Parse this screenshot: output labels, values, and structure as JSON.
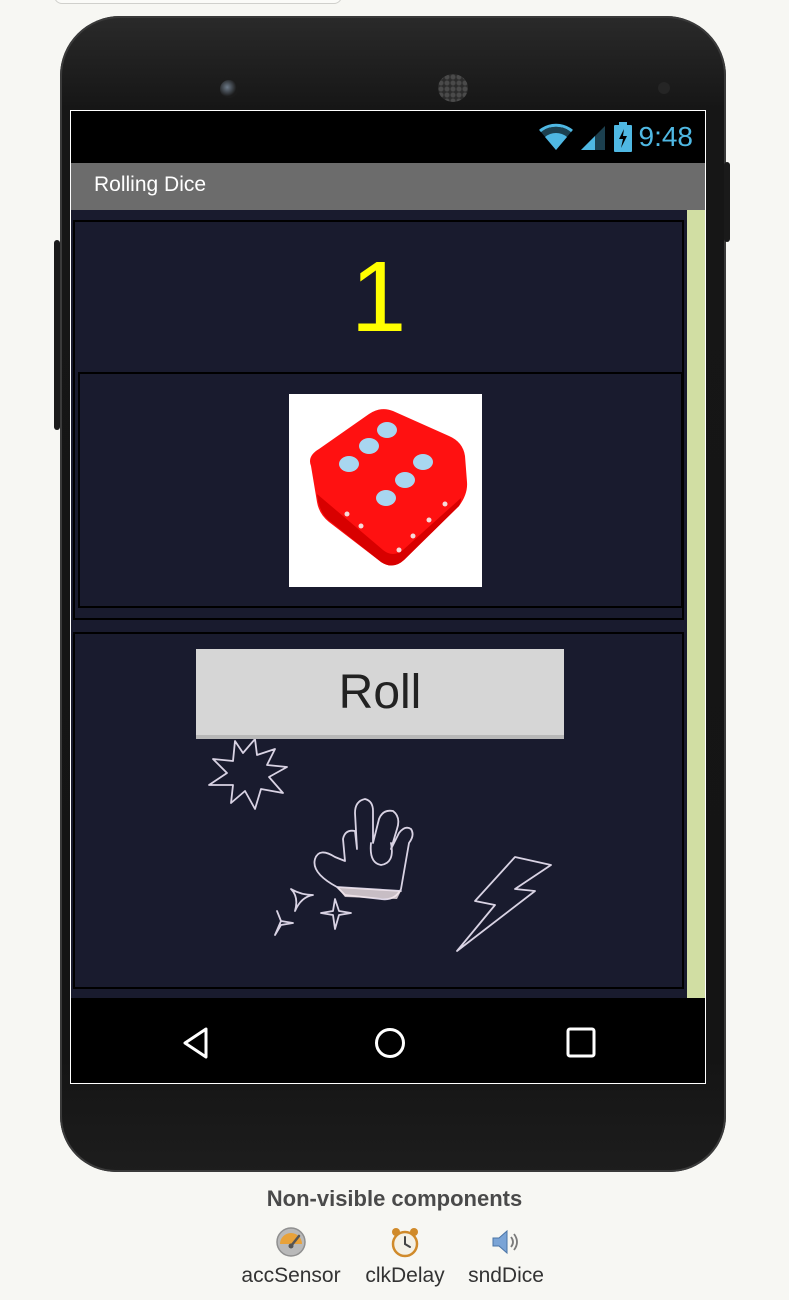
{
  "status_bar": {
    "time": "9:48"
  },
  "app_bar": {
    "title": "Rolling Dice"
  },
  "main": {
    "dice_number": "1",
    "roll_button_label": "Roll"
  },
  "nav_bar": {
    "back": "back-icon",
    "home": "home-icon",
    "recents": "recents-icon"
  },
  "non_visible": {
    "title": "Non-visible components",
    "items": [
      {
        "label": "accSensor",
        "icon": "accelerometer-icon"
      },
      {
        "label": "clkDelay",
        "icon": "clock-icon"
      },
      {
        "label": "sndDice",
        "icon": "sound-icon"
      }
    ]
  },
  "colors": {
    "number": "#ffff00",
    "content_bg": "#191b2e",
    "app_bar": "#6c6c6c",
    "status_icons": "#4fb8e3",
    "dice": "#ff0000"
  }
}
